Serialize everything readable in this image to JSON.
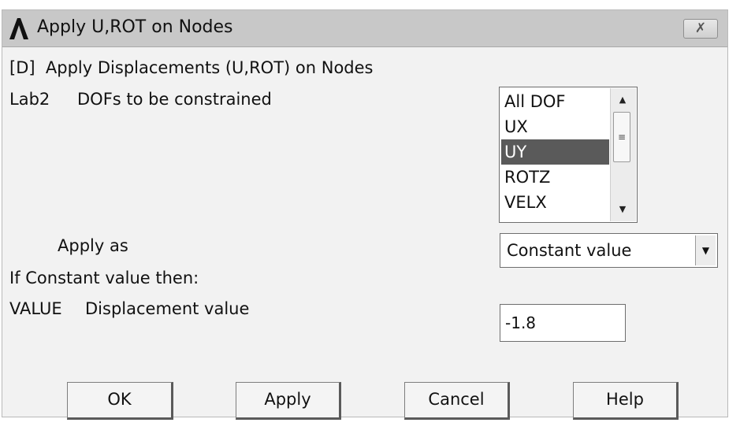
{
  "window": {
    "title": "Apply U,ROT on Nodes",
    "close_glyph": "✗",
    "logo_icon": "ansys-logo"
  },
  "header": {
    "command_line": "[D]  Apply Displacements (U,ROT) on Nodes"
  },
  "lab2": {
    "code": "Lab2",
    "label": "DOFs to be constrained",
    "options": [
      "All DOF",
      "UX",
      "UY",
      "ROTZ",
      "VELX"
    ],
    "selected": "UY"
  },
  "apply_as": {
    "label": "Apply as",
    "value": "Constant value"
  },
  "constant_note": "If Constant value then:",
  "value_field": {
    "code": "VALUE",
    "label": "Displacement value",
    "value": "-1.8"
  },
  "buttons": {
    "ok": "OK",
    "apply": "Apply",
    "cancel": "Cancel",
    "help": "Help"
  },
  "colors": {
    "selection": "#5a5a5a",
    "titlebar": "#c8c8c8",
    "dialog_bg": "#f2f2f2"
  }
}
